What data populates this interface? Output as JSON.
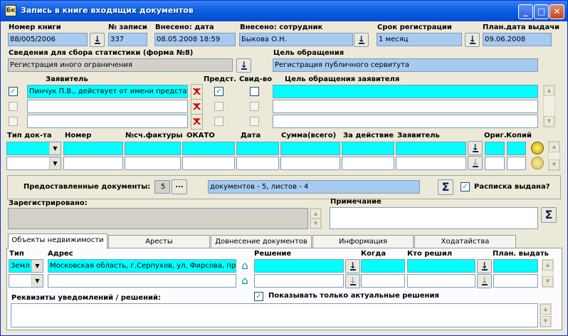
{
  "window": {
    "title": "Запись в книге входящих документов",
    "icon": "app-book-icon"
  },
  "header": {
    "book_number": {
      "label": "Номер книги",
      "value": "88/005/2006"
    },
    "record_number": {
      "label": "№ записи",
      "value": "337"
    },
    "entered_date": {
      "label": "Внесено: дата",
      "value": "08.05.2008 18:59"
    },
    "entered_by": {
      "label": "Внесено: сотрудник",
      "value": "Быкова О.Н."
    },
    "reg_term": {
      "label": "Срок регистрации",
      "value": "1 месяц"
    },
    "plan_date": {
      "label": "План.дата выдачи",
      "value": "09.06.2008"
    }
  },
  "stats": {
    "label": "Сведения для сбора статистики (форма №8)",
    "value": "Регистрация иного ограничения"
  },
  "purpose": {
    "label": "Цель обращения",
    "value": "Регистрация публичного сервитута"
  },
  "applicants": {
    "col_applicant": "Заявитель",
    "col_repr": "Предст.",
    "col_cert": "Свид-во",
    "col_purpose": "Цель обращения заявителя",
    "rows": [
      {
        "checked": true,
        "name": "Пинчук П.В., действует от имени представл",
        "repr": true,
        "cert": false,
        "purpose": ""
      },
      {
        "checked": false,
        "name": "",
        "repr": false,
        "cert": false,
        "purpose": ""
      },
      {
        "checked": false,
        "name": "",
        "repr": false,
        "cert": false,
        "purpose": ""
      }
    ]
  },
  "docs_grid": {
    "columns": [
      "Тип док-та",
      "Номер",
      "№сч.фактуры",
      "ОКАТО",
      "Дата",
      "Сумма(всего)",
      "За действие",
      "Заявитель",
      "Ориг.",
      "Копий"
    ]
  },
  "provided": {
    "label": "Предоставленные документы:",
    "count": "5",
    "ellipsis": "...",
    "summary": "документов - 5, листов - 4",
    "receipt_label": "Расписка выдана?",
    "receipt_checked": true
  },
  "registered": {
    "label": "Зарегистрировано:",
    "value": ""
  },
  "note": {
    "label": "Примечание",
    "value": ""
  },
  "tabs": [
    {
      "label": "Объекты недвижимости",
      "active": true
    },
    {
      "label": "Аресты",
      "active": false
    },
    {
      "label": "Довнесение документов",
      "active": false
    },
    {
      "label": "Информация",
      "active": false
    },
    {
      "label": "Ходатайства",
      "active": false
    }
  ],
  "objects": {
    "col_type": "Тип",
    "col_address": "Адрес",
    "col_decision": "Решение",
    "col_when": "Когда",
    "col_who": "Кто решил",
    "col_plan": "План. выдать",
    "rows": [
      {
        "type": "Земл",
        "address": "Московская область, г.Серпухов, ул. Фирсова, пр",
        "decision": "",
        "when": "",
        "who": "",
        "plan": ""
      }
    ],
    "show_actual_label": "Показывать только актуальные решения",
    "show_actual_checked": true,
    "notice_label": "Реквизиты уведомлений / решений:"
  },
  "sigma": "Σ"
}
